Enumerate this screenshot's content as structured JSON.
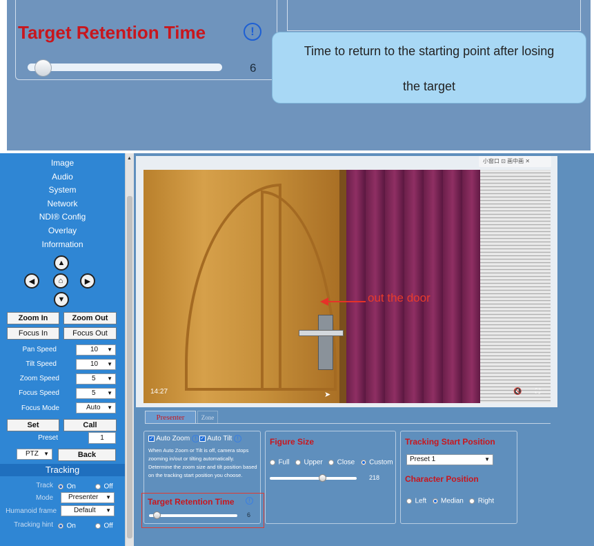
{
  "callout": {
    "title": "Target Retention Time",
    "info_glyph": "!",
    "slider_value": "6",
    "slider_fraction": 0.05,
    "tooltip_line1": "Time to return to the starting point after losing",
    "tooltip_line2": "the target"
  },
  "sidebar": {
    "menu": [
      "Image",
      "Audio",
      "System",
      "Network",
      "NDI® Config",
      "Overlay",
      "Information"
    ],
    "ptz_icons": {
      "up": "up-arrow-icon",
      "left": "left-arrow-icon",
      "home": "home-icon",
      "right": "right-arrow-icon",
      "down": "down-arrow-icon"
    },
    "zoom_in": "Zoom In",
    "zoom_out": "Zoom Out",
    "focus_in": "Focus In",
    "focus_out": "Focus Out",
    "pan_speed_label": "Pan Speed",
    "pan_speed_value": "10",
    "tilt_speed_label": "Tilt Speed",
    "tilt_speed_value": "10",
    "zoom_speed_label": "Zoom Speed",
    "zoom_speed_value": "5",
    "focus_speed_label": "Focus Speed",
    "focus_speed_value": "5",
    "focus_mode_label": "Focus Mode",
    "focus_mode_value": "Auto",
    "set_label": "Set",
    "call_label": "Call",
    "preset_label": "Preset",
    "preset_value": "1",
    "ptz_select": "PTZ",
    "back_label": "Back",
    "tracking_header": "Tracking",
    "track_label": "Track",
    "on_label": "On",
    "off_label": "Off",
    "mode_label": "Mode",
    "mode_value": "Presenter",
    "humanoid_label": "Humanoid frame",
    "humanoid_value": "Default",
    "hint_label": "Tracking hint"
  },
  "video": {
    "pip_bar": "小窗口 ⊡ 画中画 ✕",
    "annotation": "out the door",
    "time": "14:27"
  },
  "tabs": {
    "presenter": "Presenter",
    "zone": "Zone"
  },
  "presenter": {
    "auto_zoom": "Auto Zoom",
    "auto_tilt": "Auto Tilt",
    "description": "When Auto Zoom or Tilt is off, camera stops zooming in/out or tilting automatically. Determine the zoom size and tilt position based on the tracking start position you choose.",
    "retention_title": "Target Retention Time",
    "retention_value": "6",
    "figure_title": "Figure Size",
    "figure_options": [
      "Full",
      "Upper",
      "Close",
      "Custom"
    ],
    "figure_value": "218",
    "figure_fraction": 0.6,
    "tracking_start_title": "Tracking Start Position",
    "tracking_start_value": "Preset 1",
    "character_title": "Character Position",
    "character_options": [
      "Left",
      "Median",
      "Right"
    ]
  },
  "colors": {
    "accent_red": "#c8161d",
    "sidebar_blue": "#2f86d4",
    "tooltip_blue": "#a8d8f5"
  }
}
